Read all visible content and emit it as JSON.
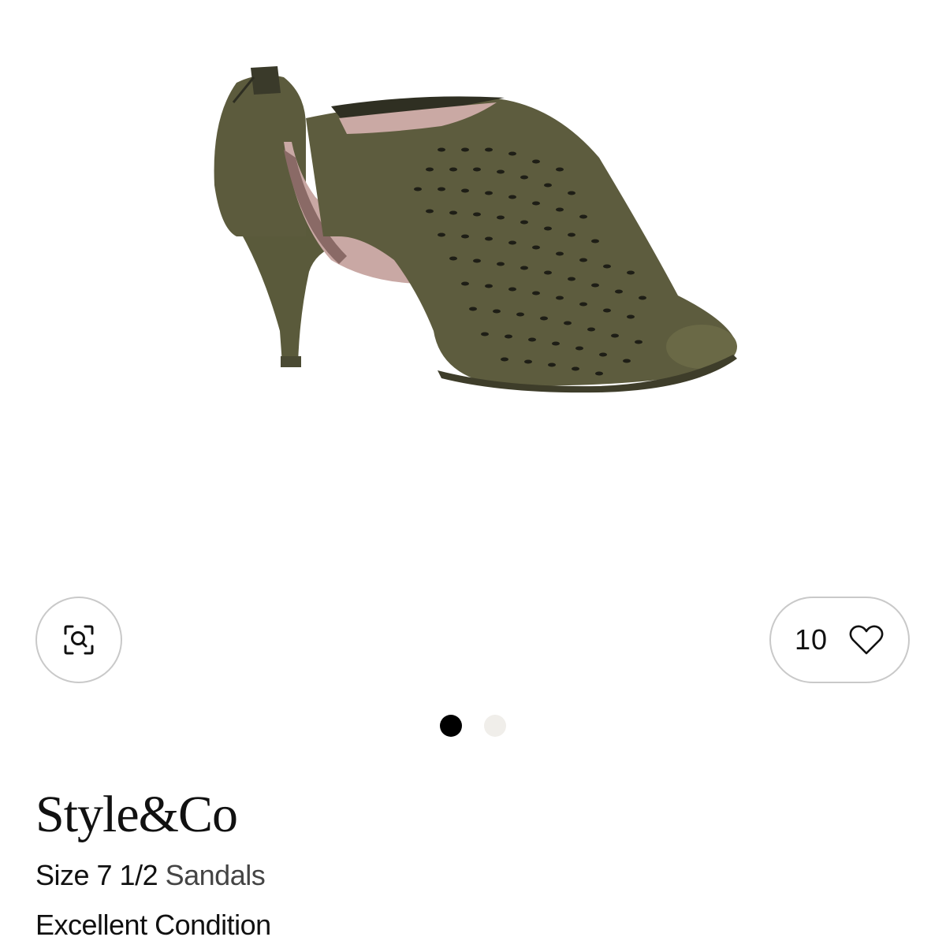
{
  "product": {
    "brand": "Style&Co",
    "size_label": "Size 7 1/2",
    "category": "Sandals",
    "condition": "Excellent Condition"
  },
  "favorites": {
    "count": "10",
    "icon": "heart-icon"
  },
  "visual_search": {
    "icon": "visual-search-icon"
  },
  "carousel": {
    "total": 2,
    "active_index": 0
  },
  "colors": {
    "shoe": "#5b5a3c",
    "border": "#c9c9c9",
    "dot_active": "#000000",
    "dot_inactive": "#f0eeea"
  }
}
